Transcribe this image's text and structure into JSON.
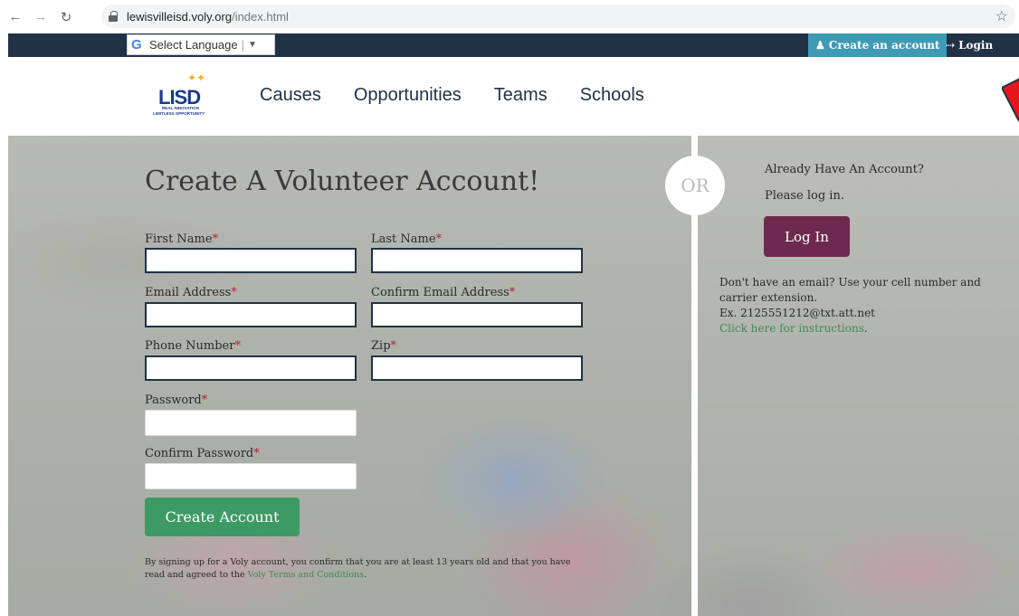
{
  "browser": {
    "url_domain": "lewisvilleisd.voly.org",
    "url_path": "/index.html"
  },
  "topbar": {
    "translate_label": "Select Language",
    "create_account": "Create an account",
    "login": "Login"
  },
  "header": {
    "logo_text": "LISD",
    "logo_tag1": "REAL INNOVATION",
    "logo_tag2": "LIMITLESS OPPORTUNITY",
    "menu": [
      "Causes",
      "Opportunities",
      "Teams",
      "Schools"
    ]
  },
  "form": {
    "title": "Create A Volunteer Account!",
    "first_name": "First Name",
    "last_name": "Last Name",
    "email": "Email Address",
    "confirm_email": "Confirm Email Address",
    "phone": "Phone Number",
    "zip": "Zip",
    "password": "Password",
    "confirm_password": "Confirm Password",
    "required_mark": "*",
    "submit": "Create Account",
    "terms_text": "By signing up for a Voly account, you confirm that you are at least 13 years old and that you have read and agreed to the ",
    "terms_link": "Voly Terms and Conditions",
    "terms_end": "."
  },
  "or_label": "OR",
  "login_panel": {
    "already": "Already Have An Account?",
    "please": "Please log in.",
    "login_button": "Log In",
    "help_line1": "Don't have an email? Use your cell number and carrier extension.",
    "help_line2": "Ex. 2125551212@txt.att.net",
    "help_link": "Click here for instructions",
    "help_end": "."
  },
  "colors": {
    "navy": "#213247",
    "teal": "#3f9bb5",
    "green": "#3d9a64",
    "maroon": "#6e2a4e",
    "required": "#b0243a"
  }
}
